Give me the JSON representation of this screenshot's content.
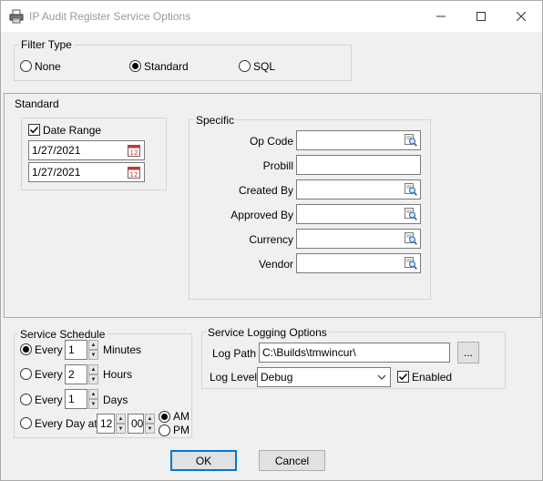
{
  "window": {
    "title": "IP Audit Register Service Options",
    "minimize": "—",
    "maximize": "☐",
    "close": "✕"
  },
  "filter_type": {
    "legend": "Filter Type",
    "options": [
      {
        "label": "None",
        "selected": false
      },
      {
        "label": "Standard",
        "selected": true
      },
      {
        "label": "SQL",
        "selected": false
      }
    ]
  },
  "standard": {
    "legend": "Standard",
    "date_range": {
      "label": "Date Range",
      "checked": true,
      "from": "1/27/2021",
      "to": "1/27/2021"
    },
    "specific": {
      "legend": "Specific",
      "fields": [
        {
          "label": "Op Code",
          "value": "",
          "lookup": true
        },
        {
          "label": "Probill",
          "value": "",
          "lookup": false
        },
        {
          "label": "Created By",
          "value": "",
          "lookup": true
        },
        {
          "label": "Approved By",
          "value": "",
          "lookup": true
        },
        {
          "label": "Currency",
          "value": "",
          "lookup": true
        },
        {
          "label": "Vendor",
          "value": "",
          "lookup": true
        }
      ]
    }
  },
  "service_schedule": {
    "legend": "Service Schedule",
    "every_minutes": {
      "label": "Every",
      "value": "1",
      "unit": "Minutes",
      "selected": true
    },
    "every_hours": {
      "label": "Every",
      "value": "2",
      "unit": "Hours",
      "selected": false
    },
    "every_days": {
      "label": "Every",
      "value": "1",
      "unit": "Days",
      "selected": false
    },
    "every_day_at": {
      "label": "Every Day at",
      "hour": "12",
      "minute": "00",
      "selected": false
    },
    "am_label": "AM",
    "pm_label": "PM",
    "am_selected": true
  },
  "logging": {
    "legend": "Service Logging Options",
    "log_path_label": "Log Path",
    "log_path": "C:\\Builds\\tmwincur\\",
    "browse_label": "...",
    "log_level_label": "Log Level",
    "log_level": "Debug",
    "enabled_label": "Enabled",
    "enabled": true
  },
  "buttons": {
    "ok": "OK",
    "cancel": "Cancel"
  }
}
